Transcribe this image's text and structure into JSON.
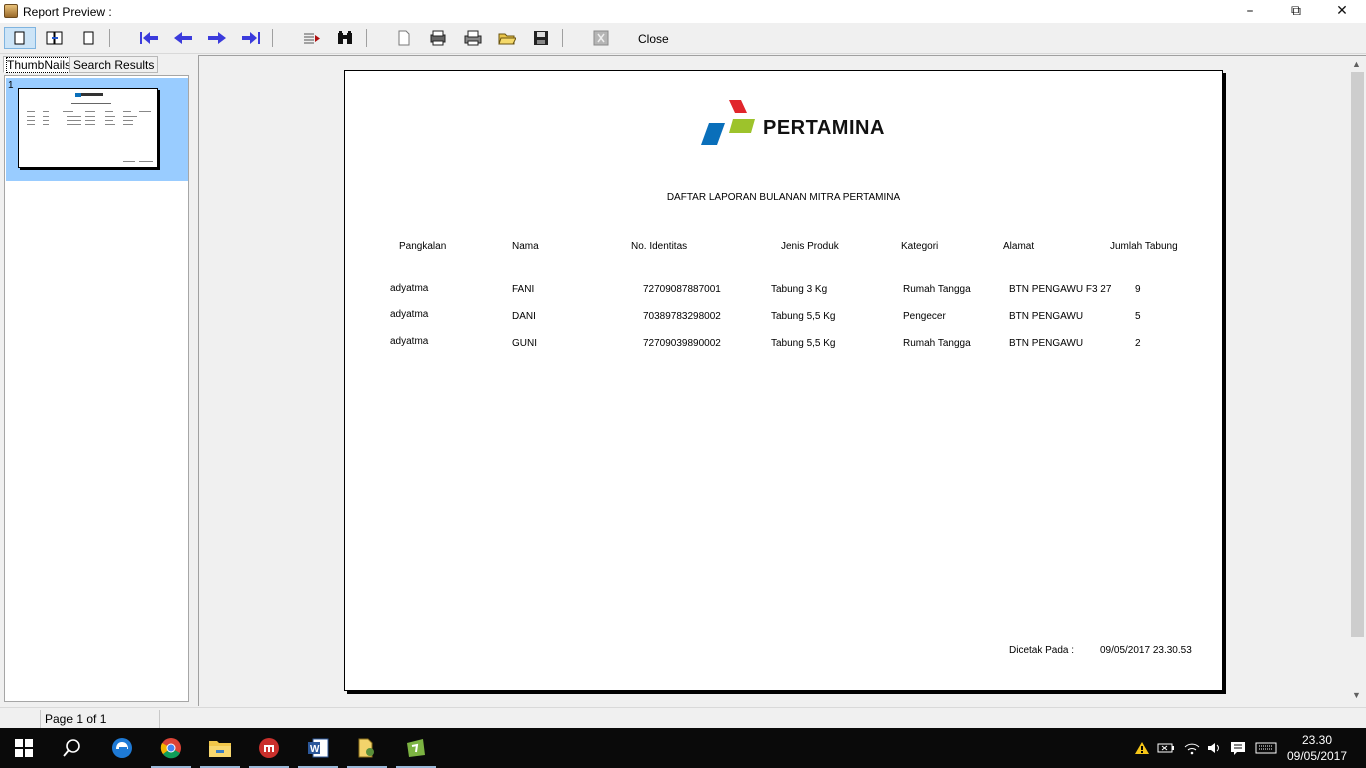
{
  "window": {
    "title": "Report Preview :",
    "minimize_icon": "minimize-icon",
    "restore_icon": "restore-icon",
    "close_icon": "close-icon"
  },
  "toolbar": {
    "buttons": [
      {
        "name": "single-page",
        "icon": "page-view-icon"
      },
      {
        "name": "two-pages",
        "icon": "two-page-view-icon"
      },
      {
        "name": "page-width",
        "icon": "page-width-icon"
      },
      {
        "name": "first-page",
        "icon": "first-page-icon"
      },
      {
        "name": "previous-page",
        "icon": "previous-page-icon"
      },
      {
        "name": "next-page",
        "icon": "next-page-icon"
      },
      {
        "name": "last-page",
        "icon": "last-page-icon"
      },
      {
        "name": "goto-page",
        "icon": "goto-page-icon"
      },
      {
        "name": "find",
        "icon": "binoculars-icon"
      },
      {
        "name": "page-setup",
        "icon": "page-setup-icon"
      },
      {
        "name": "printer-setup",
        "icon": "printer-setup-icon"
      },
      {
        "name": "print",
        "icon": "print-icon"
      },
      {
        "name": "open",
        "icon": "open-folder-icon"
      },
      {
        "name": "save",
        "icon": "save-icon"
      },
      {
        "name": "export",
        "icon": "export-icon"
      }
    ],
    "close_label": "Close"
  },
  "left_panel": {
    "tabs": [
      "ThumbNails",
      "Search Results"
    ],
    "thumbnails": [
      {
        "number": "1"
      }
    ]
  },
  "report": {
    "logo_text": "PERTAMINA",
    "title": "DAFTAR LAPORAN BULANAN MITRA PERTAMINA",
    "columns": [
      "Pangkalan",
      "Nama",
      "No. Identitas",
      "Jenis Produk",
      "Kategori",
      "Alamat",
      "Jumlah Tabung"
    ],
    "rows": [
      [
        "adyatma",
        "FANI",
        "72709087887001",
        "Tabung 3 Kg",
        "Rumah Tangga",
        "BTN PENGAWU F3 27",
        "9"
      ],
      [
        "adyatma",
        "DANI",
        "70389783298002",
        "Tabung 5,5 Kg",
        "Pengecer",
        "BTN PENGAWU",
        "5"
      ],
      [
        "adyatma",
        "GUNI",
        "72709039890002",
        "Tabung 5,5 Kg",
        "Rumah Tangga",
        "BTN PENGAWU",
        "2"
      ]
    ],
    "printed_label": "Dicetak Pada :",
    "printed_value": "09/05/2017 23.30.53"
  },
  "status": {
    "page_indicator": "Page 1 of 1"
  },
  "taskbar": {
    "apps": [
      "start-icon",
      "search-icon",
      "edge-icon",
      "chrome-icon",
      "file-explorer-icon",
      "app-icon",
      "word-icon",
      "folder-app-icon",
      "store-app-icon"
    ],
    "clock_time": "23.30",
    "clock_date": "09/05/2017"
  },
  "colors": {
    "selection_blue": "#99ccff",
    "toolbar_arrow_blue": "#3b3bdc",
    "logo_red": "#e1252b",
    "logo_green": "#9dc32b",
    "logo_blue": "#0a6fba"
  }
}
